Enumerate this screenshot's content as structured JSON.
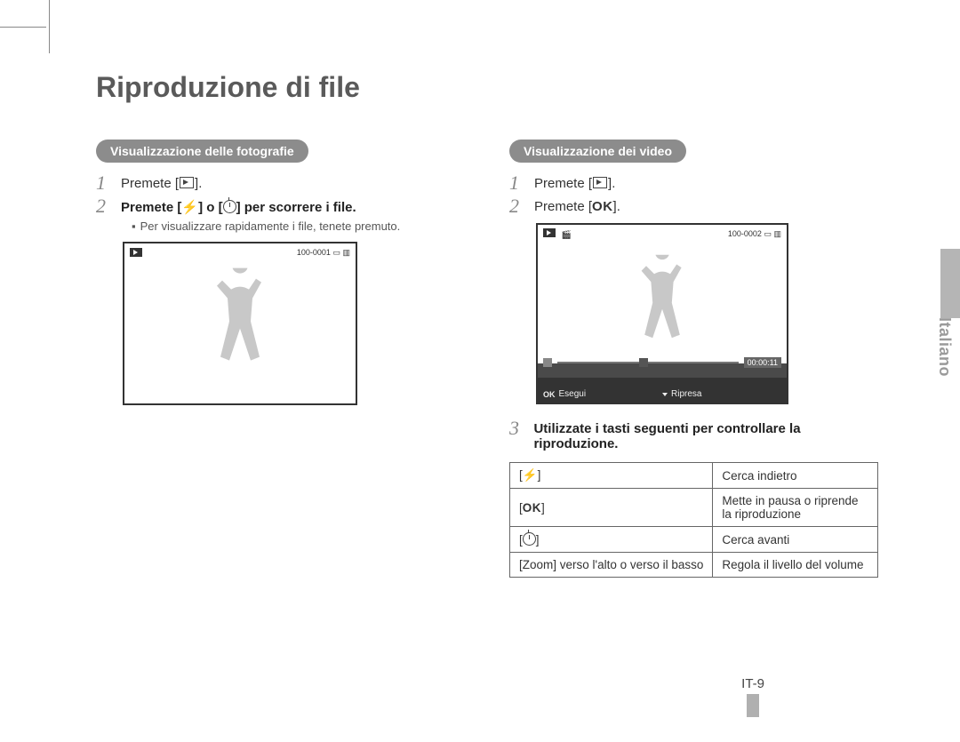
{
  "title": "Riproduzione di file",
  "language_tab": "Italiano",
  "page_number": "IT-9",
  "left": {
    "pill": "Visualizzazione delle fotografie",
    "steps": [
      {
        "num": "1",
        "prefix": "Premete [",
        "icon": "play-box",
        "suffix": "]."
      },
      {
        "num": "2",
        "prefix": "Premete [",
        "icons": [
          "flash",
          "or",
          "timer"
        ],
        "suffix": "] per scorrere i file."
      }
    ],
    "sub_note": "Per visualizzare rapidamente i file, tenete premuto.",
    "photo_counter": "100-0001"
  },
  "right": {
    "pill": "Visualizzazione dei video",
    "steps": [
      {
        "num": "1",
        "prefix": "Premete [",
        "icon": "play-box",
        "suffix": "]."
      },
      {
        "num": "2",
        "prefix": "Premete [",
        "ok": "OK",
        "suffix": "]."
      }
    ],
    "video": {
      "counter": "100-0002",
      "time": "00:00:11",
      "footer_left_ok": "OK",
      "footer_left": "Esegui",
      "footer_right": "Ripresa"
    },
    "step3": {
      "num": "3",
      "text": "Utilizzate i tasti seguenti per controllare la riproduzione."
    },
    "table": [
      {
        "key_type": "flash",
        "desc": "Cerca indietro"
      },
      {
        "key_type": "ok",
        "desc": "Mette in pausa o riprende la riproduzione"
      },
      {
        "key_type": "timer",
        "desc": "Cerca avanti"
      },
      {
        "key_text": "[Zoom] verso l'alto o verso il basso",
        "desc": "Regola il livello del volume"
      }
    ]
  },
  "or_word": "o"
}
